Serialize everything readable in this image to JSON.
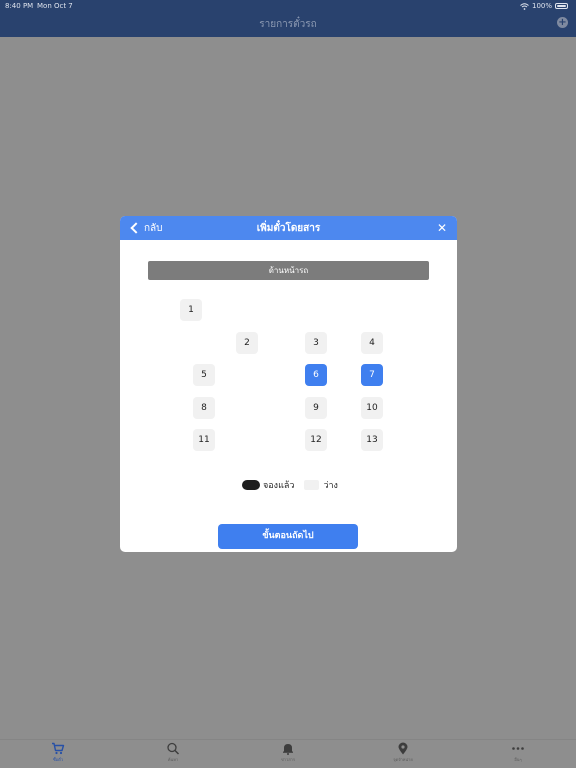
{
  "status_bar": {
    "time": "8:40 PM",
    "date": "Mon Oct 7",
    "battery": "100%"
  },
  "nav": {
    "title": "รายการตั๋วรถ"
  },
  "modal": {
    "back_label": "กลับ",
    "title": "เพิ่มตั๋วโดยสาร",
    "close_label": "✕",
    "front_label": "ด้านหน้ารถ",
    "seats": [
      "1",
      "2",
      "3",
      "4",
      "5",
      "6",
      "7",
      "8",
      "9",
      "10",
      "11",
      "12",
      "13"
    ],
    "selected_seats": [
      "6",
      "7"
    ],
    "legend": {
      "booked": "จองแล้ว",
      "free": "ว่าง"
    },
    "next_label": "ขั้นตอนถัดไป"
  },
  "tabs": [
    {
      "label": "ซื้อตั๋ว",
      "icon": "cart-icon",
      "active": true
    },
    {
      "label": "ค้นหา",
      "icon": "search-icon",
      "active": false
    },
    {
      "label": "ข่าวสาร",
      "icon": "bell-icon",
      "active": false
    },
    {
      "label": "จุดจำหน่าย",
      "icon": "location-pin-icon",
      "active": false
    },
    {
      "label": "อื่นๆ",
      "icon": "more-icon",
      "active": false
    }
  ],
  "colors": {
    "nav_bg": "#29426e",
    "modal_header": "#4d88ef",
    "selected_seat": "#3f7fef",
    "tab_active": "#2750a6"
  }
}
